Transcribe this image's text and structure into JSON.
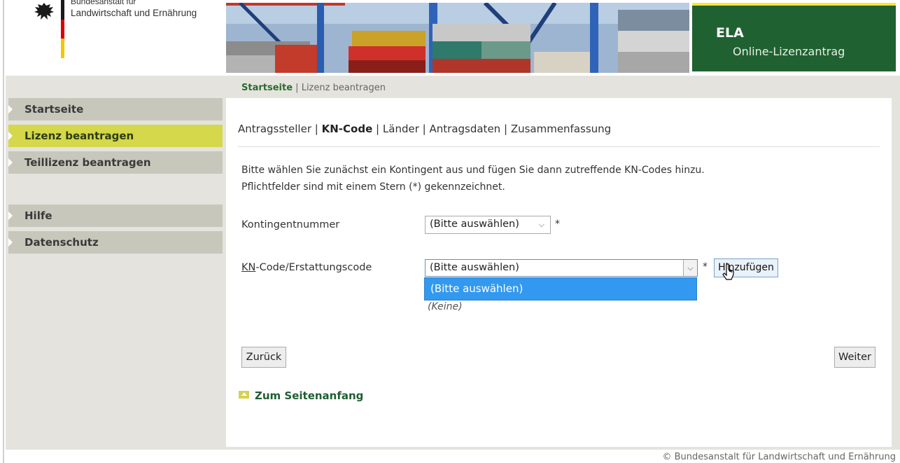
{
  "header": {
    "org_line1": "Bundesanstalt für",
    "org_line2": "Landwirtschaft und Ernährung",
    "app_title": "ELA",
    "app_subtitle": "Online-Lizenzantrag"
  },
  "breadcrumb": {
    "home": "Startseite",
    "separator": "|",
    "current": "Lizenz beantragen"
  },
  "sidebar": {
    "items": [
      {
        "label": "Startseite",
        "active": false
      },
      {
        "label": "Lizenz beantragen",
        "active": true
      },
      {
        "label": "Teillizenz beantragen",
        "active": false
      },
      {
        "label": "Hilfe",
        "active": false
      },
      {
        "label": "Datenschutz",
        "active": false
      }
    ]
  },
  "steps": {
    "s1": "Antragssteller",
    "s2": "KN-Code",
    "s3": "Länder",
    "s4": "Antragsdaten",
    "s5": "Zusammenfassung",
    "sep": "|"
  },
  "form": {
    "intro_line1": "Bitte wählen Sie zunächst ein Kontingent aus und fügen Sie dann zutreffende KN-Codes hinzu.",
    "intro_line2": "Pflichtfelder sind mit einem Stern (*) gekennzeichnet.",
    "kontingent_label": "Kontingentnummer",
    "kontingent_value": "(Bitte auswählen)",
    "kn_label_prefix": "KN",
    "kn_label_rest": "-Code/Erstattungscode",
    "kn_value": "(Bitte auswählen)",
    "required_mark": "*",
    "add_button": "Hinzufügen",
    "dropdown_options": [
      "(Bitte auswählen)"
    ],
    "list_empty": "(Keine)",
    "back_button": "Zurück",
    "next_button": "Weiter",
    "top_link": "Zum Seitenanfang"
  },
  "footer": {
    "copyright": "© Bundesanstalt für Landwirtschaft und Ernährung"
  },
  "colors": {
    "brand_green": "#206131",
    "nav_active": "#d4d84a",
    "nav_default": "#c8c7bc",
    "dropdown_highlight": "#3399f0"
  }
}
